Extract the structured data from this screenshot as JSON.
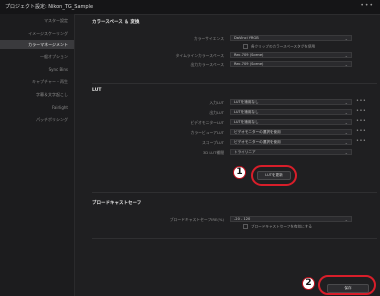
{
  "window": {
    "title": "プロジェクト設定: Nikon_TG_Sample",
    "menu_dots": "•••"
  },
  "sidebar": {
    "items": [
      {
        "label": "マスター設定",
        "active": false
      },
      {
        "label": "イメージスケーリング",
        "active": false
      },
      {
        "label": "カラーマネージメント",
        "active": true
      },
      {
        "label": "一般オプション",
        "active": false
      },
      {
        "label": "Sync Bins",
        "active": false
      },
      {
        "label": "キャプチャー・再生",
        "active": false
      },
      {
        "label": "字幕＆文字起こし",
        "active": false
      },
      {
        "label": "Fairlight",
        "active": false
      },
      {
        "label": "パッチポリシング",
        "active": false
      }
    ]
  },
  "color_space": {
    "title": "カラースペース ＆ 変換",
    "rows": [
      {
        "label": "カラーサイエンス",
        "value": "DaVinci YRGB"
      },
      {
        "label": "タイムラインカラースペース",
        "value": "Rec.709 (Scene)"
      },
      {
        "label": "出力カラースペース",
        "value": "Rec.709 (Scene)"
      }
    ],
    "checkbox_label": "各クリップのカラースペースタグを使用"
  },
  "lut": {
    "title": "LUT",
    "rows": [
      {
        "label": "入力LUT",
        "value": "LUTを適用なし"
      },
      {
        "label": "出力LUT",
        "value": "LUTを適用なし"
      },
      {
        "label": "ビデオモニターLUT",
        "value": "LUTを適用なし"
      },
      {
        "label": "カラービューアLUT",
        "value": "ビデオモニターの選択を使用"
      },
      {
        "label": "スコープLUT",
        "value": "ビデオモニターの選択を使用"
      },
      {
        "label": "3D LUT補間",
        "value": "トライリニア"
      }
    ],
    "open_lut_button": "LUTを更新"
  },
  "broadcast": {
    "title": "ブロードキャストセーフ",
    "level_label": "ブロードキャストセーフIRE(%)",
    "level_value": "-20 - 120",
    "checkbox_label": "ブロードキャストセーフを有効にする"
  },
  "footer": {
    "save_button": "保存"
  },
  "annotations": {
    "step1": "1",
    "step2": "2",
    "highlight_color": "#d81e2a"
  }
}
